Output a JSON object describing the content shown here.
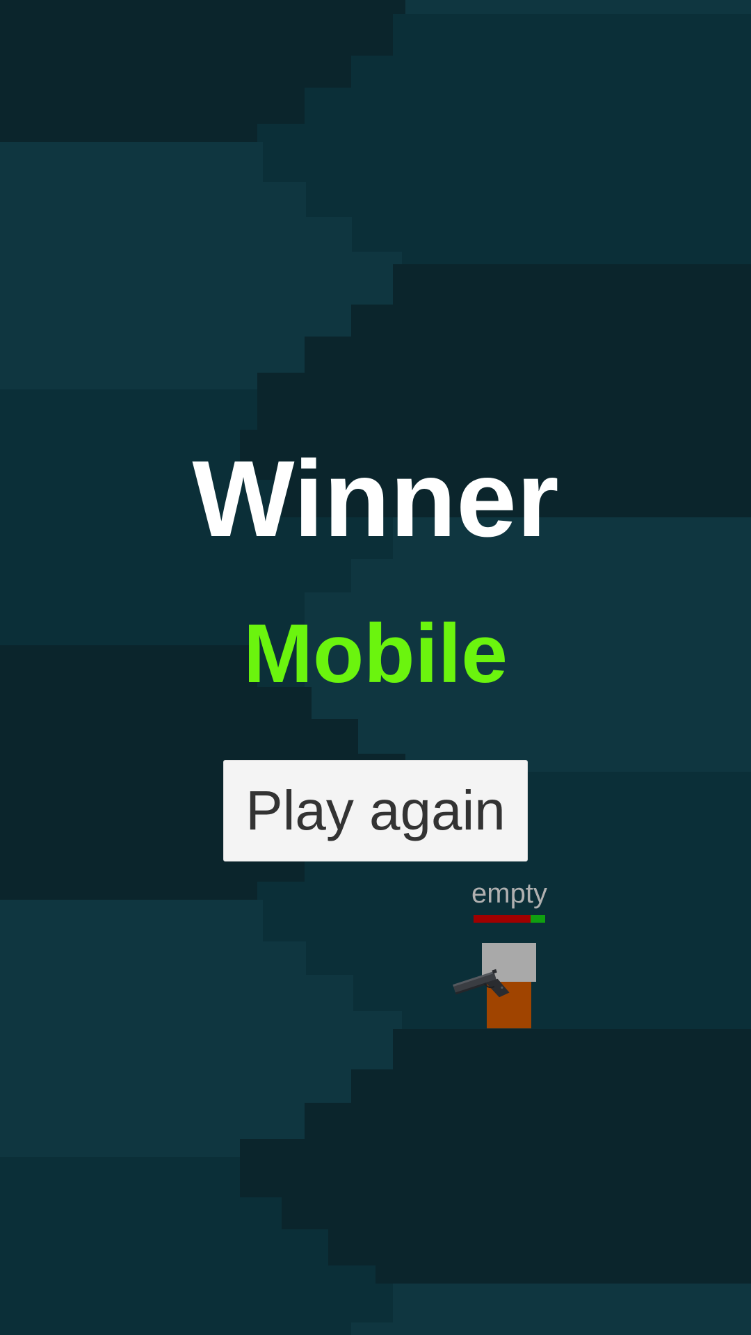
{
  "colors": {
    "background_dark": "#0b252c",
    "background_mid": "#0b2f38",
    "background_light": "#0f3640",
    "winner_title": "#ffffff",
    "winner_name": "#6bf40e",
    "button_bg": "#f4f4f4",
    "button_text": "#333333",
    "weapon_label": "#b0b0b0",
    "health_damage": "#a00000",
    "health_remaining": "#10a010",
    "player_head": "#a9a9a9",
    "player_body": "#a04400"
  },
  "game_over": {
    "title": "Winner",
    "winner_name": "Mobile",
    "play_again_label": "Play again"
  },
  "player": {
    "weapon_status": "empty",
    "health_fraction": 0.2,
    "weapon_icon": "pistol-icon"
  }
}
